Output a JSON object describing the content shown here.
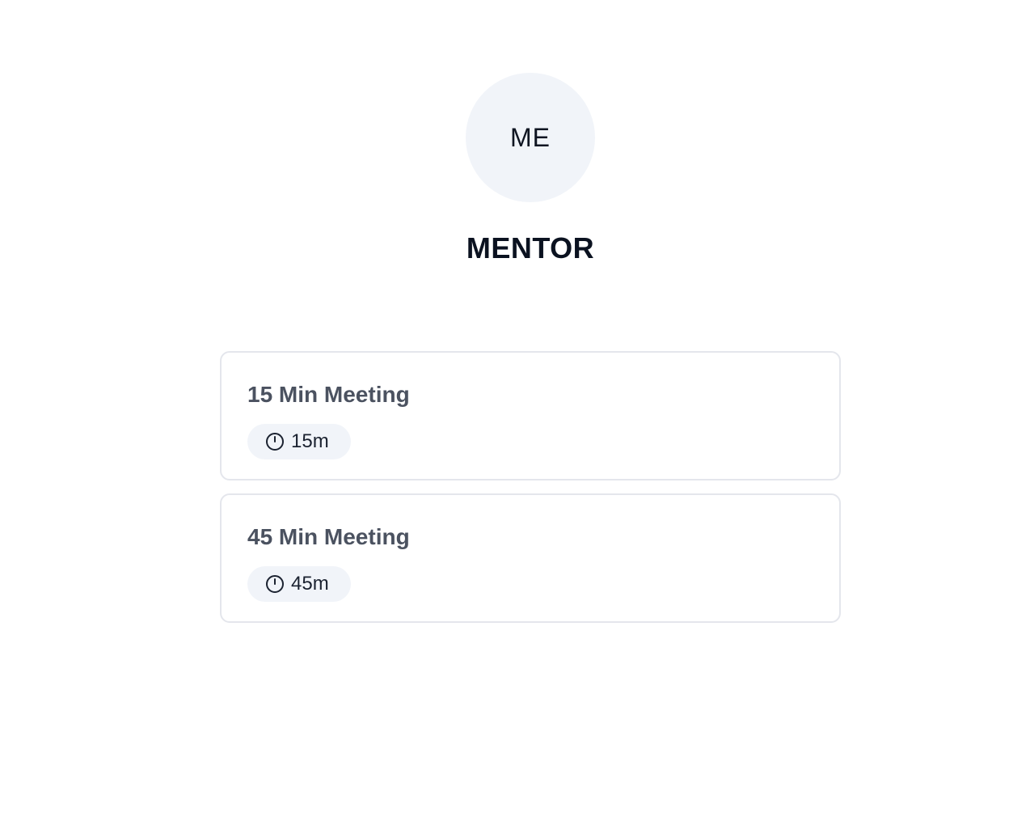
{
  "profile": {
    "initials": "ME",
    "name": "MENTOR"
  },
  "events": [
    {
      "title": "15 Min Meeting",
      "duration": "15m",
      "icon": "clock-icon"
    },
    {
      "title": "45 Min Meeting",
      "duration": "45m",
      "icon": "clock-icon"
    }
  ],
  "colors": {
    "avatar_bg": "#f1f4f9",
    "title_text": "#0b1220",
    "event_title": "#4b5260",
    "card_border": "#e4e6ec",
    "badge_bg": "#f1f4f9"
  }
}
